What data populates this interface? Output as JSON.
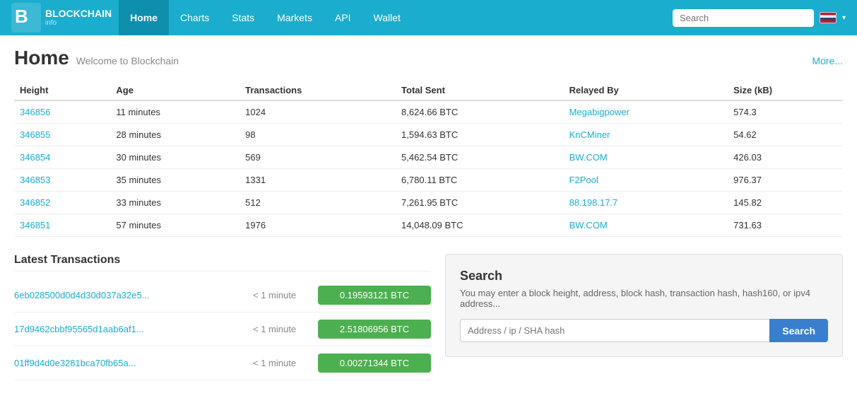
{
  "brand": {
    "name": "BLOCKCHAIN",
    "subname": "info"
  },
  "nav": {
    "items": [
      {
        "label": "Home",
        "active": true
      },
      {
        "label": "Charts",
        "active": false
      },
      {
        "label": "Stats",
        "active": false
      },
      {
        "label": "Markets",
        "active": false
      },
      {
        "label": "API",
        "active": false
      },
      {
        "label": "Wallet",
        "active": false
      }
    ],
    "search_placeholder": "Search"
  },
  "page": {
    "title": "Home",
    "subtitle": "Welcome to Blockchain",
    "more_label": "More..."
  },
  "table": {
    "columns": [
      "Height",
      "Age",
      "Transactions",
      "Total Sent",
      "Relayed By",
      "Size (kB)"
    ],
    "rows": [
      {
        "height": "346856",
        "age": "11 minutes",
        "transactions": "1024",
        "total_sent": "8,624.66 BTC",
        "relayed_by": "Megabigpower",
        "size": "574.3"
      },
      {
        "height": "346855",
        "age": "28 minutes",
        "transactions": "98",
        "total_sent": "1,594.63 BTC",
        "relayed_by": "KnCMiner",
        "size": "54.62"
      },
      {
        "height": "346854",
        "age": "30 minutes",
        "transactions": "569",
        "total_sent": "5,462.54 BTC",
        "relayed_by": "BW.COM",
        "size": "426.03"
      },
      {
        "height": "346853",
        "age": "35 minutes",
        "transactions": "1331",
        "total_sent": "6,780.11 BTC",
        "relayed_by": "F2Pool",
        "size": "976.37"
      },
      {
        "height": "346852",
        "age": "33 minutes",
        "transactions": "512",
        "total_sent": "7,261.95 BTC",
        "relayed_by": "88.198.17.7",
        "size": "145.82"
      },
      {
        "height": "346851",
        "age": "57 minutes",
        "transactions": "1976",
        "total_sent": "14,048.09 BTC",
        "relayed_by": "BW.COM",
        "size": "731.63"
      }
    ]
  },
  "latest_transactions": {
    "title": "Latest Transactions",
    "rows": [
      {
        "hash": "6eb028500d0d4d30d037a32e5...",
        "time": "< 1 minute",
        "amount": "0.19593121 BTC"
      },
      {
        "hash": "17d9462cbbf95565d1aab6af1...",
        "time": "< 1 minute",
        "amount": "2.51806956 BTC"
      },
      {
        "hash": "01ff9d4d0e3281bca70fb65a...",
        "time": "< 1 minute",
        "amount": "0.00271344 BTC"
      }
    ]
  },
  "search_panel": {
    "title": "Search",
    "description": "You may enter a block height, address, block hash, transaction hash, hash160, or ipv4 address...",
    "input_placeholder": "Address / ip / SHA hash",
    "button_label": "Search"
  }
}
